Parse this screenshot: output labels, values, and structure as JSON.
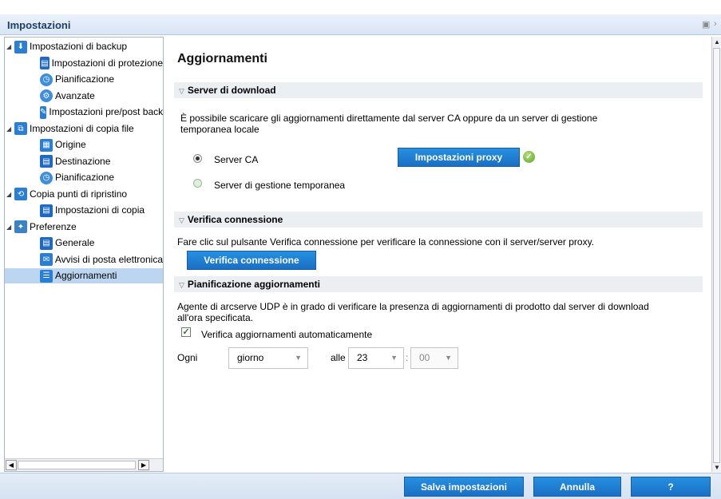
{
  "window": {
    "title": "Impostazioni"
  },
  "tree": {
    "items": [
      {
        "label": "Impostazioni di backup",
        "level": 0,
        "icon": "backup-icon"
      },
      {
        "label": "Impostazioni di protezione",
        "level": 1,
        "icon": "document-icon"
      },
      {
        "label": "Pianificazione",
        "level": 1,
        "icon": "clock-icon"
      },
      {
        "label": "Avanzate",
        "level": 1,
        "icon": "gear-icon"
      },
      {
        "label": "Impostazioni pre/post backup",
        "level": 1,
        "icon": "script-icon"
      },
      {
        "label": "Impostazioni di copia file",
        "level": 0,
        "icon": "file-copy-icon"
      },
      {
        "label": "Origine",
        "level": 1,
        "icon": "source-icon"
      },
      {
        "label": "Destinazione",
        "level": 1,
        "icon": "document-icon"
      },
      {
        "label": "Pianificazione",
        "level": 1,
        "icon": "clock-icon"
      },
      {
        "label": "Copia punti di ripristino",
        "level": 0,
        "icon": "recovery-point-icon"
      },
      {
        "label": "Impostazioni di copia",
        "level": 1,
        "icon": "document-icon"
      },
      {
        "label": "Preferenze",
        "level": 0,
        "icon": "preferences-icon"
      },
      {
        "label": "Generale",
        "level": 1,
        "icon": "document-icon"
      },
      {
        "label": "Avvisi di posta elettronica",
        "level": 1,
        "icon": "email-icon"
      },
      {
        "label": "Aggiornamenti",
        "level": 1,
        "icon": "updates-icon",
        "selected": true
      }
    ]
  },
  "main": {
    "title": "Aggiornamenti",
    "download_server": {
      "header": "Server di download",
      "description_line1": "È possibile scaricare gli aggiornamenti direttamente dal server CA oppure da un server di gestione",
      "description_line2": "temporanea locale",
      "option_ca": "Server CA",
      "option_staging": "Server di gestione temporanea",
      "selected": "Server CA",
      "proxy_button": "Impostazioni proxy"
    },
    "connection": {
      "header": "Verifica connessione",
      "description": "Fare clic sul pulsante Verifica connessione per verificare la connessione con il server/server proxy.",
      "button": "Verifica connessione"
    },
    "schedule": {
      "header": "Pianificazione aggiornamenti",
      "description_line1": "Agente di arcserve UDP è in grado di verificare la presenza di aggiornamenti di prodotto dal server di download",
      "description_line2": "all'ora specificata.",
      "auto_check_label": "Verifica aggiornamenti automaticamente",
      "auto_check": true,
      "every_label": "Ogni",
      "frequency": "giorno",
      "at_label": "alle",
      "hour": "23",
      "separator": ":",
      "minute": "00"
    }
  },
  "footer": {
    "save": "Salva impostazioni",
    "cancel": "Annulla",
    "help": "?"
  },
  "colors": {
    "button_blue": "#1f7fd4",
    "selected_row": "#bcd6f2",
    "section_bg": "#eceff2"
  }
}
